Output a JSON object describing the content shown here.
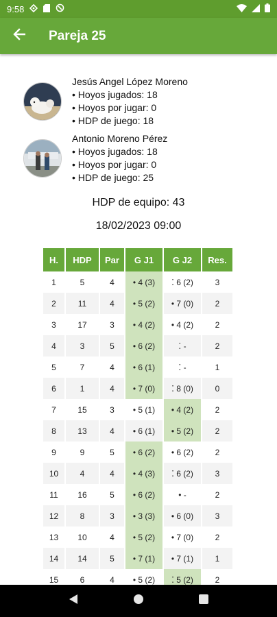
{
  "status_bar": {
    "time": "9:58"
  },
  "app_bar": {
    "title": "Pareja 25"
  },
  "players": [
    {
      "name": "Jesús Angel López Moreno",
      "holes_played": "• Hoyos jugados: 18",
      "holes_left": "• Hoyos por jugar: 0",
      "hdp": "• HDP de juego: 18"
    },
    {
      "name": "Antonio Moreno Pérez",
      "holes_played": "• Hoyos jugados: 18",
      "holes_left": "• Hoyos por jugar: 0",
      "hdp": "• HDP de juego: 25"
    }
  ],
  "team_hdp": "HDP de equipo: 43",
  "date": "18/02/2023 09:00",
  "table": {
    "headers": [
      "H.",
      "HDP",
      "Par",
      "G J1",
      "G J2",
      "Res."
    ],
    "rows": [
      {
        "h": "1",
        "hdp": "5",
        "par": "4",
        "j1": "• 4 (3)",
        "j2": "⁚ 6 (2)",
        "res": "3",
        "win1": true,
        "win2": false
      },
      {
        "h": "2",
        "hdp": "11",
        "par": "4",
        "j1": "• 5 (2)",
        "j2": "• 7 (0)",
        "res": "2",
        "win1": true,
        "win2": false
      },
      {
        "h": "3",
        "hdp": "17",
        "par": "3",
        "j1": "• 4 (2)",
        "j2": "• 4 (2)",
        "res": "2",
        "win1": true,
        "win2": false
      },
      {
        "h": "4",
        "hdp": "3",
        "par": "5",
        "j1": "• 6 (2)",
        "j2": "⁚  -",
        "res": "2",
        "win1": true,
        "win2": false
      },
      {
        "h": "5",
        "hdp": "7",
        "par": "4",
        "j1": "• 6 (1)",
        "j2": "⁚  -",
        "res": "1",
        "win1": true,
        "win2": false
      },
      {
        "h": "6",
        "hdp": "1",
        "par": "4",
        "j1": "• 7 (0)",
        "j2": "⁚ 8 (0)",
        "res": "0",
        "win1": true,
        "win2": false
      },
      {
        "h": "7",
        "hdp": "15",
        "par": "3",
        "j1": "• 5 (1)",
        "j2": "• 4 (2)",
        "res": "2",
        "win1": false,
        "win2": true
      },
      {
        "h": "8",
        "hdp": "13",
        "par": "4",
        "j1": "• 6 (1)",
        "j2": "• 5 (2)",
        "res": "2",
        "win1": false,
        "win2": true
      },
      {
        "h": "9",
        "hdp": "9",
        "par": "5",
        "j1": "• 6 (2)",
        "j2": "• 6 (2)",
        "res": "2",
        "win1": true,
        "win2": false
      },
      {
        "h": "10",
        "hdp": "4",
        "par": "4",
        "j1": "• 4 (3)",
        "j2": "⁚ 6 (2)",
        "res": "3",
        "win1": true,
        "win2": false
      },
      {
        "h": "11",
        "hdp": "16",
        "par": "5",
        "j1": "• 6 (2)",
        "j2": "•  -",
        "res": "2",
        "win1": true,
        "win2": false
      },
      {
        "h": "12",
        "hdp": "8",
        "par": "3",
        "j1": "• 3 (3)",
        "j2": "• 6 (0)",
        "res": "3",
        "win1": true,
        "win2": false
      },
      {
        "h": "13",
        "hdp": "10",
        "par": "4",
        "j1": "• 5 (2)",
        "j2": "• 7 (0)",
        "res": "2",
        "win1": true,
        "win2": false
      },
      {
        "h": "14",
        "hdp": "14",
        "par": "5",
        "j1": "• 7 (1)",
        "j2": "• 7 (1)",
        "res": "1",
        "win1": true,
        "win2": false
      },
      {
        "h": "15",
        "hdp": "6",
        "par": "4",
        "j1": "• 5 (2)",
        "j2": "⁚ 5 (2)",
        "res": "2",
        "win1": false,
        "win2": true
      }
    ]
  },
  "colors": {
    "primary": "#67a83a",
    "status_bar": "#5f9d2e",
    "highlight": "#cfe3bd"
  }
}
